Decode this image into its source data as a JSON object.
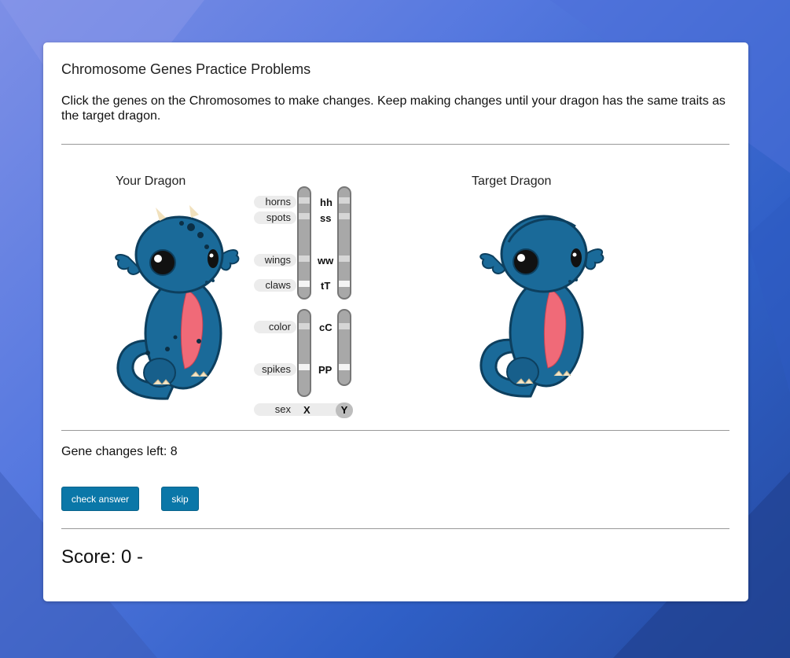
{
  "page": {
    "title": "Chromosome Genes Practice Problems",
    "instructions": "Click the genes on the Chromosomes to make changes. Keep making changes until your dragon has the same traits as the target dragon."
  },
  "your_dragon": {
    "label": "Your Dragon"
  },
  "target_dragon": {
    "label": "Target Dragon"
  },
  "genes": [
    {
      "trait": "horns",
      "alleles": "hh"
    },
    {
      "trait": "spots",
      "alleles": "ss"
    },
    {
      "trait": "wings",
      "alleles": "ww"
    },
    {
      "trait": "claws",
      "alleles": "tT"
    },
    {
      "trait": "color",
      "alleles": "cC"
    },
    {
      "trait": "spikes",
      "alleles": "PP"
    }
  ],
  "sex": {
    "trait": "sex",
    "x": "X",
    "y": "Y"
  },
  "status": {
    "gene_changes_left": "Gene changes left: 8"
  },
  "buttons": {
    "check_answer": "check answer",
    "skip": "skip"
  },
  "score": {
    "text": "Score: 0 -"
  },
  "colors": {
    "dragon_body": "#1a6a99",
    "dragon_belly": "#f06a78",
    "button": "#0a77a8"
  }
}
